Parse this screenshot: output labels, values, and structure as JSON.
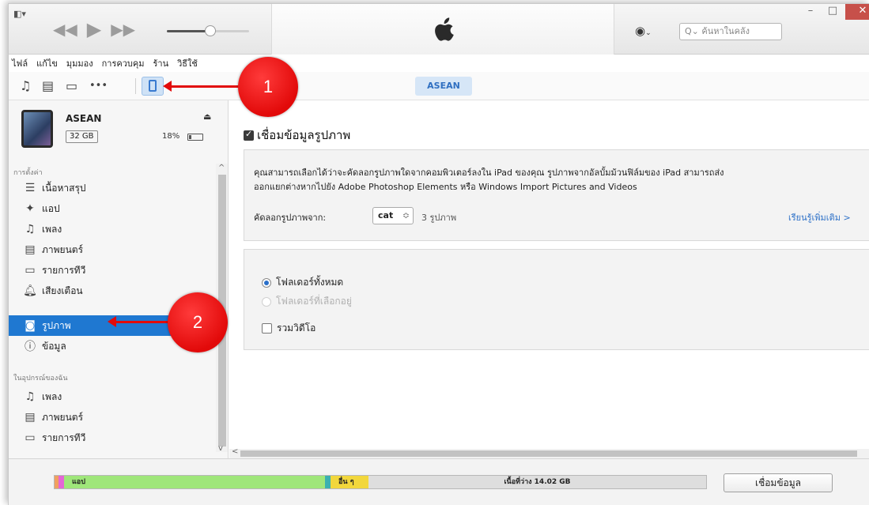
{
  "titlebar": {
    "search_placeholder": "ค้นหาในคลัง",
    "search_prefix": "Q⌄"
  },
  "menu": [
    "ไฟล์",
    "แก้ไข",
    "มุมมอง",
    "การควบคุม",
    "ร้าน",
    "วิธีใช้"
  ],
  "toolbar": {
    "device_pill": "ASEAN"
  },
  "device": {
    "name": "ASEAN",
    "capacity": "32 GB",
    "battery": "18%"
  },
  "sidebar": {
    "settings_header": "การตั้งค่า",
    "settings_items": [
      {
        "label": "เนื้อหาสรุป",
        "icon": "summary-icon"
      },
      {
        "label": "แอป",
        "icon": "apps-icon"
      },
      {
        "label": "เพลง",
        "icon": "music-icon"
      },
      {
        "label": "ภาพยนตร์",
        "icon": "movies-icon"
      },
      {
        "label": "รายการทีวี",
        "icon": "tv-icon"
      },
      {
        "label": "เสียงเตือน",
        "icon": "tones-icon"
      },
      {
        "label": "รูปภาพ",
        "icon": "photos-icon"
      },
      {
        "label": "ข้อมูล",
        "icon": "info-icon"
      }
    ],
    "ondevice_header": "ในอุปกรณ์ของฉัน",
    "ondevice_items": [
      {
        "label": "เพลง",
        "icon": "music-icon"
      },
      {
        "label": "ภาพยนตร์",
        "icon": "movies-icon"
      },
      {
        "label": "รายการทีวี",
        "icon": "tv-icon"
      }
    ]
  },
  "main": {
    "sync_photos_label": "เชื่อมข้อมูลรูปภาพ",
    "description_line1": "คุณสามารถเลือกได้ว่าจะคัดลอกรูปภาพใดจากคอมพิวเตอร์ลงใน iPad ของคุณ รูปภาพจากอัลบั้มม้วนฟิล์มของ iPad สามารถส่ง",
    "description_line2": "ออกแยกต่างหากไปยัง Adobe Photoshop Elements หรือ Windows Import Pictures and Videos",
    "copy_from_label": "คัดลอกรูปภาพจาก:",
    "copy_from_value": "cat",
    "photo_count": "3 รูปภาพ",
    "learn_more": "เรียนรู้เพิ่มเติม >",
    "opt_all_folders": "โฟลเดอร์ทั้งหมด",
    "opt_selected_folders": "โฟลเดอร์ที่เลือกอยู่",
    "include_videos": "รวมวิดีโอ"
  },
  "capacity_bar": {
    "segments": [
      {
        "label": "",
        "color": "#f0a060",
        "fraction": 0.006
      },
      {
        "label": "",
        "color": "#e466d6",
        "fraction": 0.008
      },
      {
        "label": "แอป",
        "color": "#9fe67a",
        "fraction": 0.4
      },
      {
        "label": "",
        "color": "#3bb0b0",
        "fraction": 0.008
      },
      {
        "label": "อื่น ๆ",
        "color": "#f2d73c",
        "fraction": 0.058
      },
      {
        "label": "เนื้อที่ว่าง 14.02 GB",
        "color": "#dedede",
        "fraction": 0.52
      }
    ],
    "sync_button": "เชื่อมข้อมูล"
  },
  "annotations": {
    "callout_1": "1",
    "callout_2": "2"
  }
}
